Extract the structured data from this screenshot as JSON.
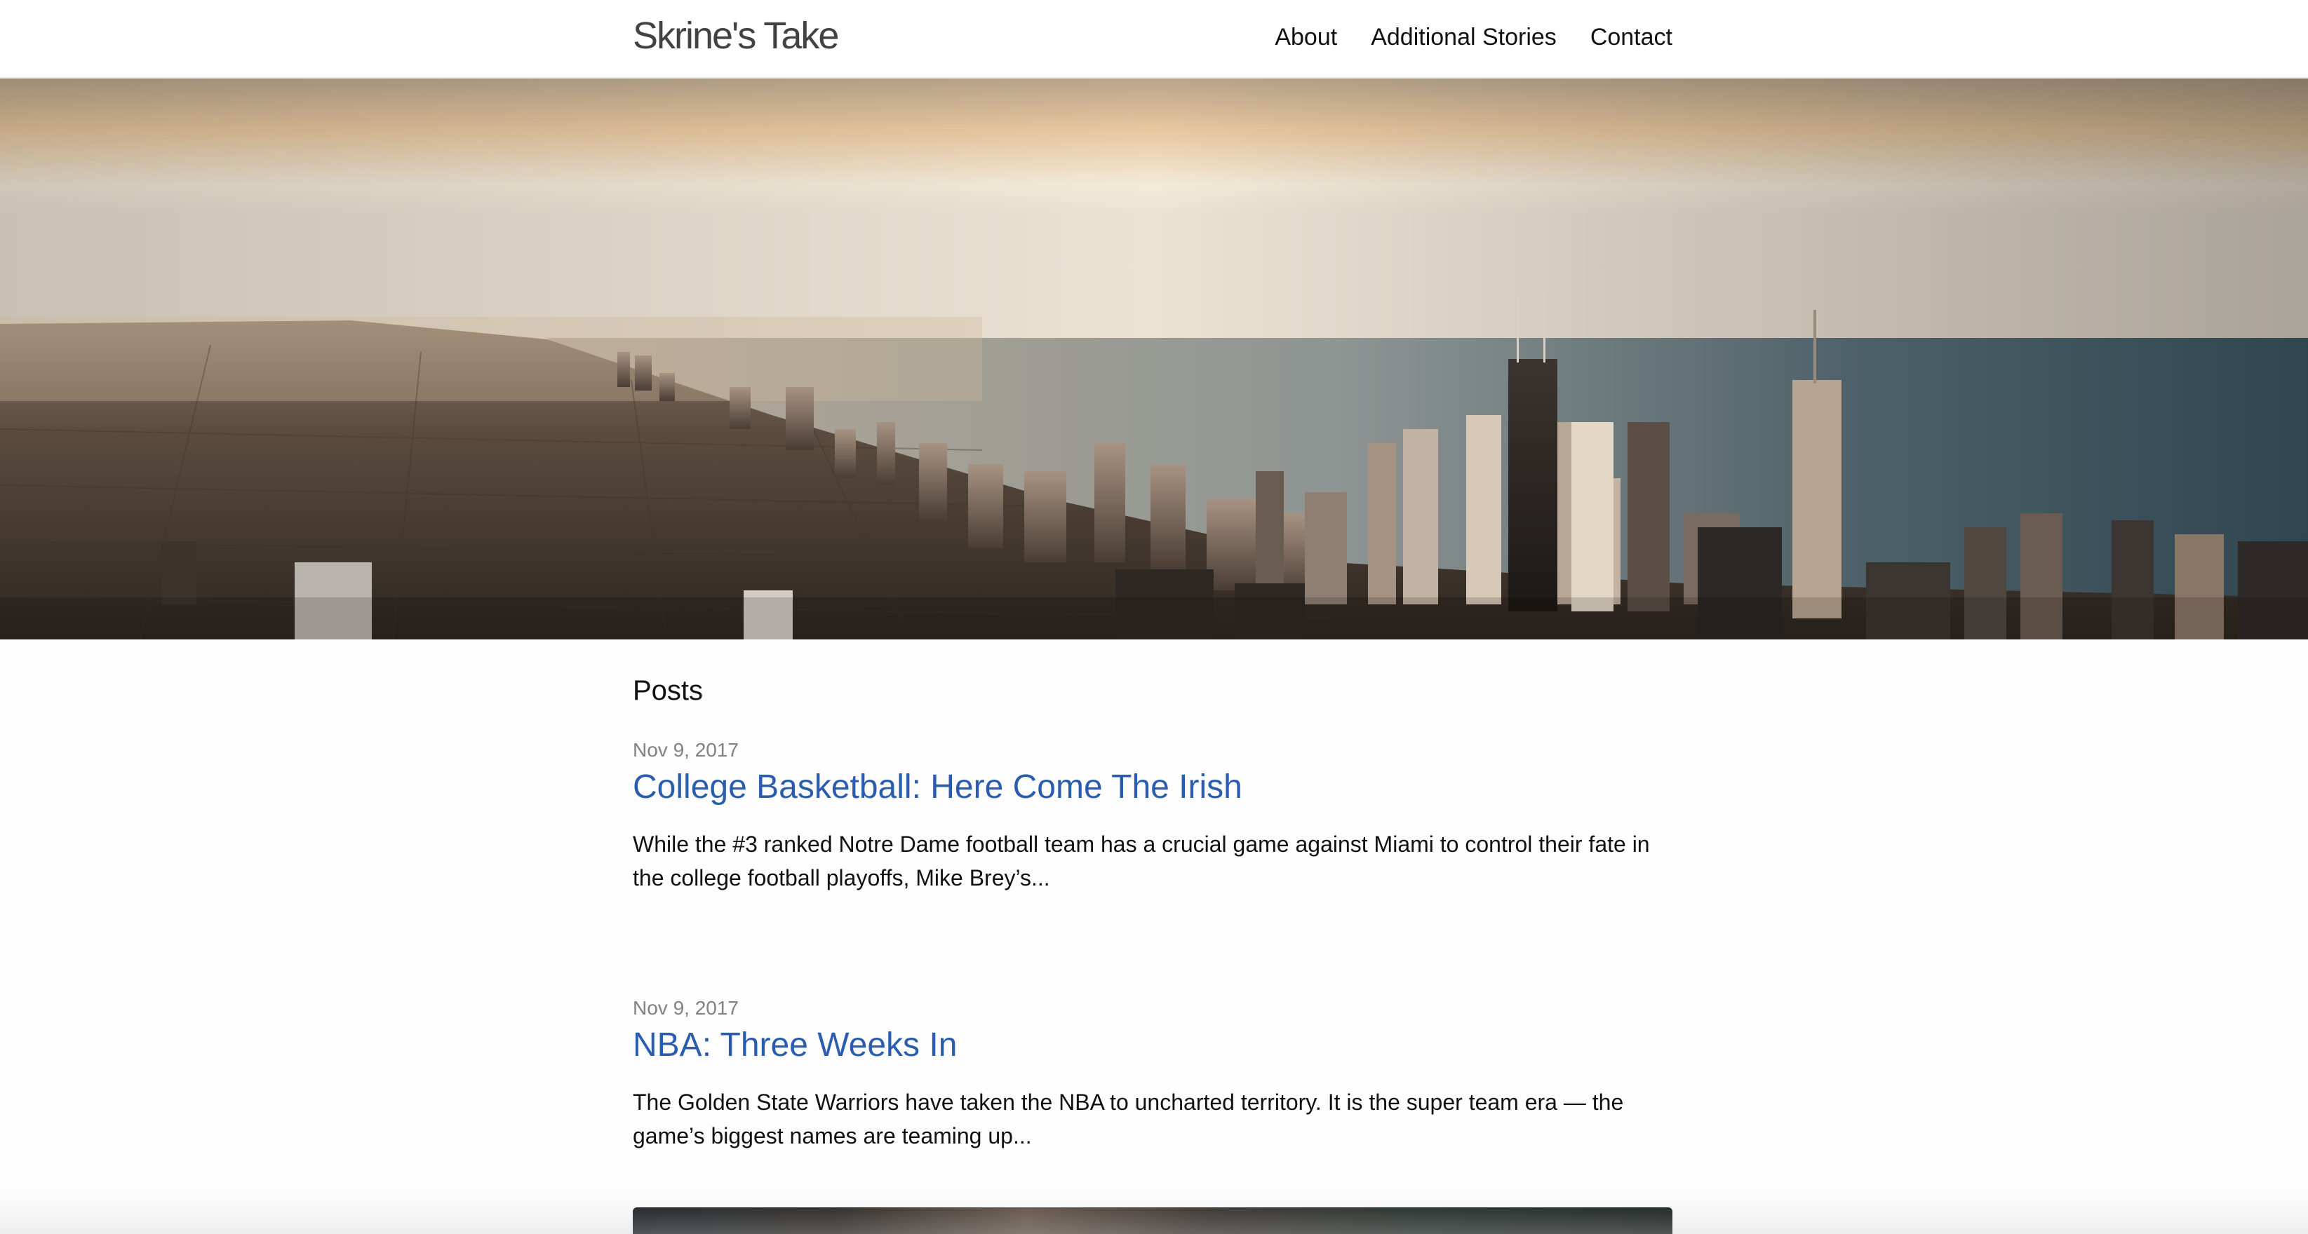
{
  "header": {
    "site_title": "Skrine's Take",
    "nav": [
      {
        "label": "About"
      },
      {
        "label": "Additional Stories"
      },
      {
        "label": "Contact"
      }
    ]
  },
  "hero": {
    "description": "City skyline"
  },
  "main": {
    "heading": "Posts",
    "posts": [
      {
        "date": "Nov 9, 2017",
        "title": "College Basketball: Here Come The Irish",
        "excerpt": "While the #3 ranked Notre Dame football team has a crucial game against Miami to control their fate in the college football playoffs, Mike Brey’s..."
      },
      {
        "date": "Nov 9, 2017",
        "title": "NBA: Three Weeks In",
        "excerpt": "The Golden State Warriors have taken the NBA to uncharted territory. It is the super team era — the game’s biggest names are teaming up..."
      }
    ]
  },
  "colors": {
    "link": "#2a5db0",
    "meta": "#828282",
    "text": "#111111"
  }
}
